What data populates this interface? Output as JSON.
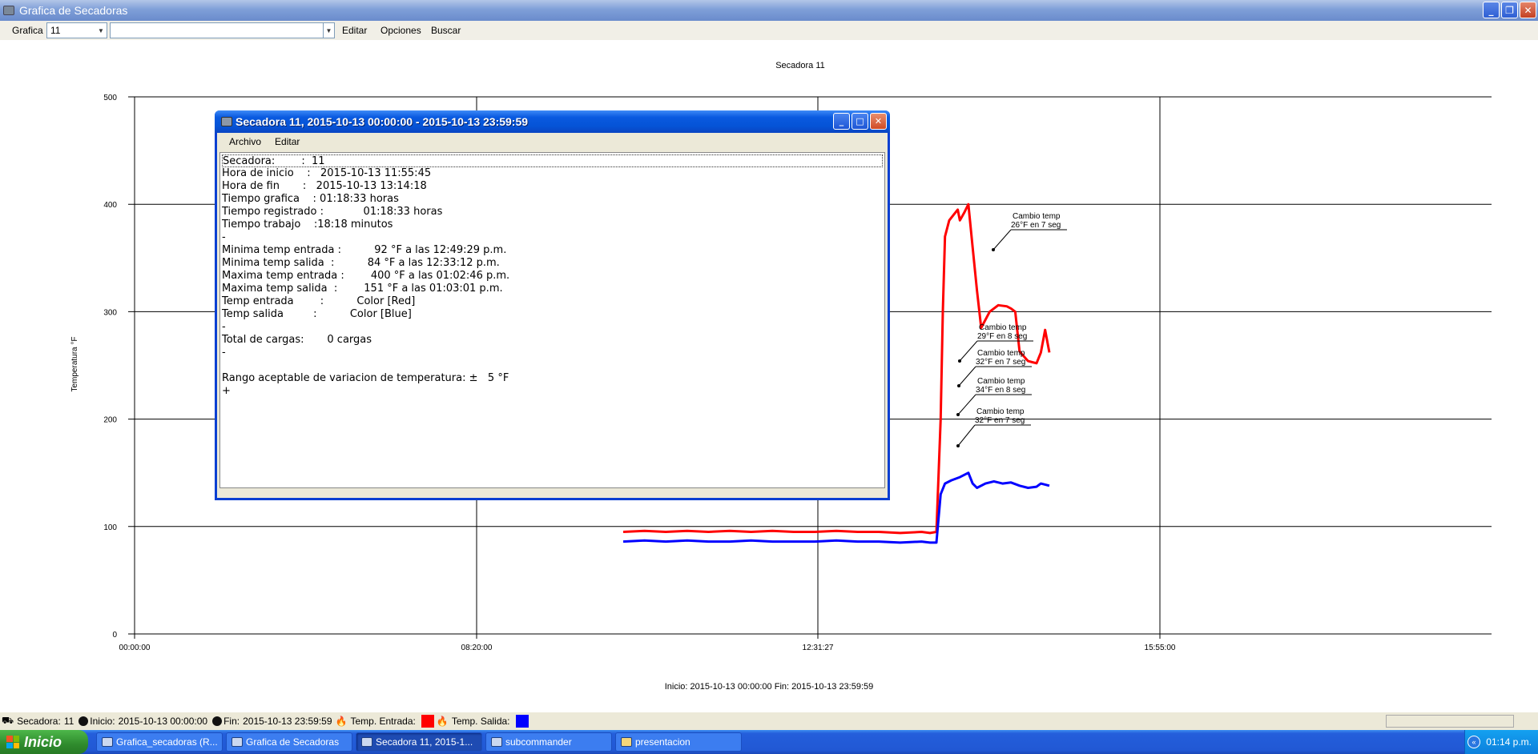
{
  "main_window": {
    "title": "Grafica de Secadoras"
  },
  "toolbar": {
    "grafica_label": "Grafica",
    "secadora_value": "11",
    "search_value": "",
    "menu": [
      "Editar",
      "Opciones",
      "Buscar"
    ]
  },
  "chart": {
    "title": "Secadora 11",
    "ylabel": "Temperatura °F",
    "caption": "Inicio: 2015-10-13 00:00:00 Fin: 2015-10-13 23:59:59",
    "annotations": [
      {
        "line1": "Cambio temp",
        "line2": "26°F en 7 seg"
      },
      {
        "line1": "Cambio temp",
        "line2": "29°F en 8 seg"
      },
      {
        "line1": "Cambio temp",
        "line2": "32°F en 7 seg"
      },
      {
        "line1": "Cambio temp",
        "line2": "34°F en 8 seg"
      },
      {
        "line1": "Cambio temp",
        "line2": "32°F en 7 seg"
      }
    ]
  },
  "chart_data": {
    "type": "line",
    "ylim": [
      0,
      500
    ],
    "yticks": [
      "500",
      "400",
      "300",
      "200",
      "100",
      "0"
    ],
    "xticks": [
      "00:00:00",
      "08:20:00",
      "12:31:27",
      "15:55:00"
    ],
    "grid": true,
    "series": [
      {
        "color": "#ff0000",
        "points": [
          [
            0,
            95
          ],
          [
            0.05,
            96
          ],
          [
            0.1,
            95
          ],
          [
            0.15,
            96
          ],
          [
            0.2,
            95
          ],
          [
            0.25,
            96
          ],
          [
            0.3,
            95
          ],
          [
            0.35,
            96
          ],
          [
            0.4,
            95
          ],
          [
            0.45,
            95
          ],
          [
            0.5,
            96
          ],
          [
            0.55,
            95
          ],
          [
            0.6,
            95
          ],
          [
            0.65,
            94
          ],
          [
            0.7,
            95
          ],
          [
            0.72,
            94
          ],
          [
            0.735,
            95
          ],
          [
            0.745,
            200
          ],
          [
            0.75,
            300
          ],
          [
            0.755,
            370
          ],
          [
            0.765,
            385
          ],
          [
            0.775,
            390
          ],
          [
            0.785,
            395
          ],
          [
            0.79,
            385
          ],
          [
            0.8,
            392
          ],
          [
            0.81,
            400
          ],
          [
            0.82,
            360
          ],
          [
            0.83,
            320
          ],
          [
            0.84,
            285
          ],
          [
            0.86,
            300
          ],
          [
            0.88,
            306
          ],
          [
            0.9,
            305
          ],
          [
            0.91,
            303
          ],
          [
            0.92,
            300
          ],
          [
            0.93,
            263
          ],
          [
            0.95,
            254
          ],
          [
            0.96,
            253
          ],
          [
            0.97,
            252
          ],
          [
            0.98,
            262
          ],
          [
            0.99,
            283
          ],
          [
            1.0,
            262
          ]
        ]
      },
      {
        "color": "#0000ff",
        "points": [
          [
            0,
            86
          ],
          [
            0.05,
            87
          ],
          [
            0.1,
            86
          ],
          [
            0.15,
            87
          ],
          [
            0.2,
            86
          ],
          [
            0.25,
            86
          ],
          [
            0.3,
            87
          ],
          [
            0.35,
            86
          ],
          [
            0.4,
            86
          ],
          [
            0.45,
            86
          ],
          [
            0.5,
            87
          ],
          [
            0.55,
            86
          ],
          [
            0.6,
            86
          ],
          [
            0.65,
            85
          ],
          [
            0.7,
            86
          ],
          [
            0.72,
            85
          ],
          [
            0.735,
            85
          ],
          [
            0.745,
            130
          ],
          [
            0.755,
            140
          ],
          [
            0.77,
            143
          ],
          [
            0.79,
            146
          ],
          [
            0.81,
            150
          ],
          [
            0.82,
            140
          ],
          [
            0.83,
            136
          ],
          [
            0.85,
            140
          ],
          [
            0.87,
            142
          ],
          [
            0.89,
            140
          ],
          [
            0.91,
            141
          ],
          [
            0.93,
            138
          ],
          [
            0.95,
            136
          ],
          [
            0.97,
            137
          ],
          [
            0.98,
            140
          ],
          [
            1.0,
            138
          ]
        ]
      }
    ]
  },
  "dialog": {
    "title": "Secadora 11, 2015-10-13 00:00:00 - 2015-10-13 23:59:59",
    "menu": [
      "Archivo",
      "Editar"
    ],
    "lines": [
      "Secadora:        :  11",
      "Hora de inicio    :   2015-10-13 11:55:45",
      "Hora de fin       :   2015-10-13 13:14:18",
      "Tiempo grafica    : 01:18:33 horas",
      "Tiempo registrado :            01:18:33 horas",
      "Tiempo trabajo    :18:18 minutos",
      "-",
      "Minima temp entrada :          92 °F a las 12:49:29 p.m.",
      "Minima temp salida  :          84 °F a las 12:33:12 p.m.",
      "Maxima temp entrada :        400 °F a las 01:02:46 p.m.",
      "Maxima temp salida  :        151 °F a las 01:03:01 p.m.",
      "Temp entrada        :          Color [Red]",
      "Temp salida         :          Color [Blue]",
      "-",
      "Total de cargas:       0 cargas",
      "-",
      "",
      "Rango aceptable de variacion de temperatura: ±   5 °F",
      "+"
    ]
  },
  "statusbar": {
    "secadora_label": "Secadora:",
    "secadora_value": "11",
    "inicio_label": "Inicio:",
    "inicio_value": "2015-10-13 00:00:00",
    "fin_label": "Fin:",
    "fin_value": "2015-10-13 23:59:59",
    "entrada_label": "Temp. Entrada:",
    "salida_label": "Temp. Salida:",
    "entrada_color": "#ff0000",
    "salida_color": "#0000ff"
  },
  "taskbar": {
    "start_label": "Inicio",
    "tasks": [
      "Grafica_secadoras (R...",
      "Grafica de Secadoras",
      "Secadora 11, 2015-1...",
      "subcommander",
      "presentacion"
    ],
    "clock": "01:14 p.m."
  }
}
